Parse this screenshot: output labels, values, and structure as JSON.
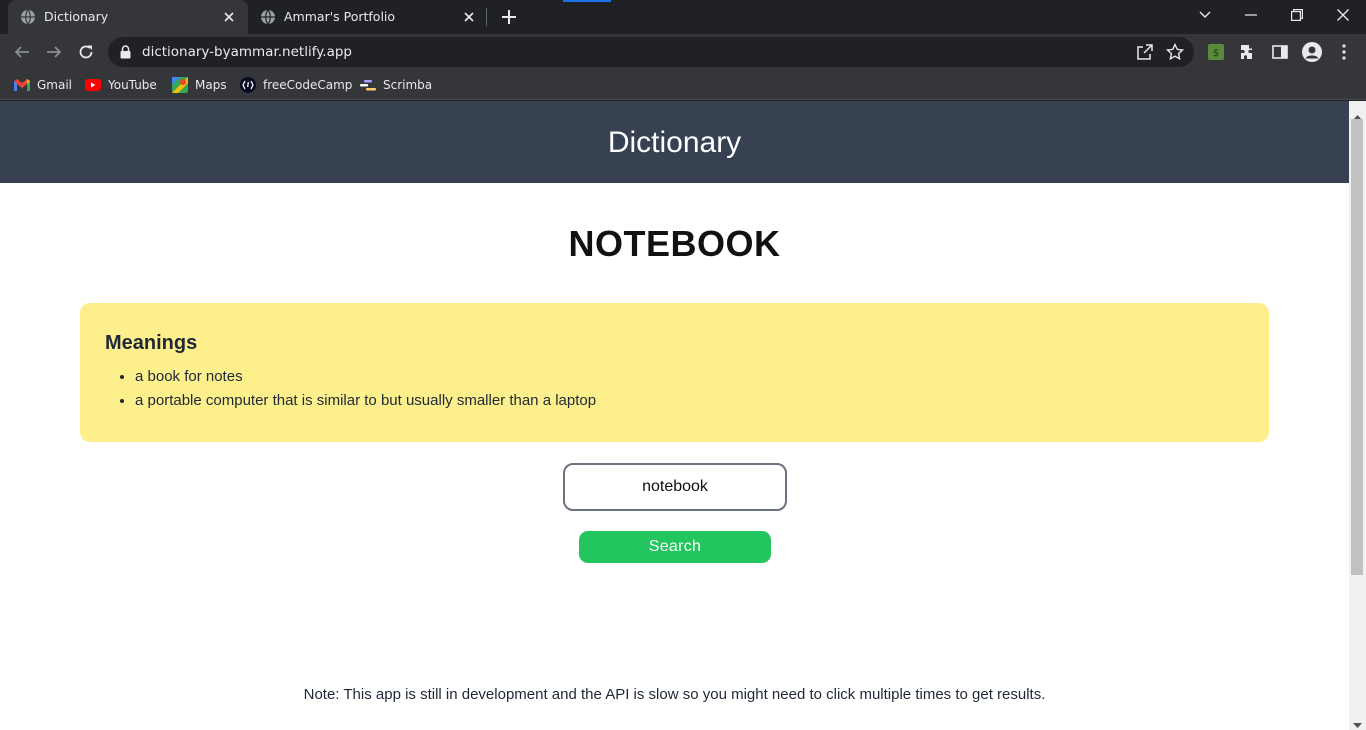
{
  "browser": {
    "tabs": [
      {
        "title": "Dictionary",
        "active": true
      },
      {
        "title": "Ammar's Portfolio",
        "active": false
      }
    ],
    "url": "dictionary-byammar.netlify.app",
    "bookmarks": [
      {
        "label": "Gmail",
        "icon": "gmail-icon"
      },
      {
        "label": "YouTube",
        "icon": "youtube-icon"
      },
      {
        "label": "Maps",
        "icon": "maps-icon"
      },
      {
        "label": "freeCodeCamp",
        "icon": "freecodecamp-icon"
      },
      {
        "label": "Scrimba",
        "icon": "scrimba-icon"
      }
    ]
  },
  "page": {
    "header_title": "Dictionary",
    "word": "NOTEBOOK",
    "meanings": {
      "heading": "Meanings",
      "items": [
        "a book for notes",
        "a portable computer that is similar to but usually smaller than a laptop"
      ]
    },
    "search": {
      "value": "notebook",
      "button_label": "Search"
    },
    "footnote": "Note: This app is still in development and the API is slow so you might need to click multiple times to get results."
  },
  "colors": {
    "header_bg": "#374151",
    "card_bg": "#fdef8c",
    "button_bg": "#22c55e",
    "browser_dark": "#202124",
    "browser_toolbar": "#35363a"
  }
}
